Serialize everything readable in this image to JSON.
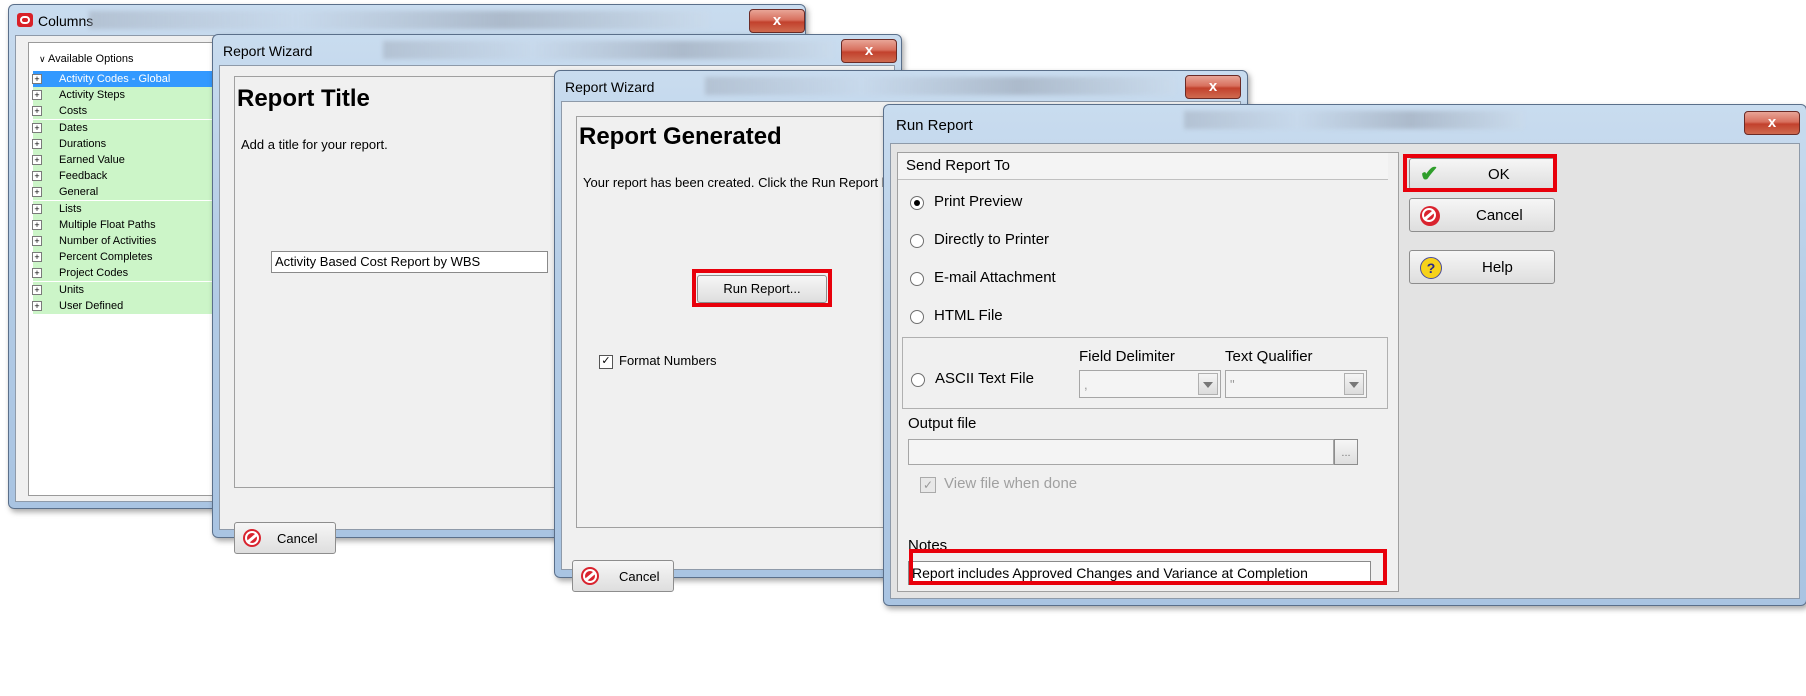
{
  "columns_window": {
    "title": "Columns",
    "tree_header": "Available Options",
    "items": [
      "Activity Codes - Global",
      "Activity Steps",
      "Costs",
      "Dates",
      "Durations",
      "Earned Value",
      "Feedback",
      "General",
      "Lists",
      "Multiple Float Paths",
      "Number of Activities",
      "Percent Completes",
      "Project Codes",
      "Units",
      "User Defined"
    ],
    "selected_index": 0,
    "close_label": "x"
  },
  "wizard1": {
    "title": "Report Wizard",
    "heading": "Report Title",
    "instruction": "Add a title for your report.",
    "title_value": "Activity Based Cost Report by WBS",
    "cancel_label": "Cancel",
    "close_label": "x"
  },
  "wizard2": {
    "title": "Report Wizard",
    "heading": "Report Generated",
    "message": "Your report has been created.  Click the Run Report b",
    "run_button_label": "Run Report...",
    "format_numbers_label": "Format Numbers",
    "format_numbers_checked": true,
    "cancel_label": "Cancel",
    "close_label": "x"
  },
  "run_report": {
    "title": "Run Report",
    "close_label": "x",
    "send_to_header": "Send Report To",
    "options": [
      {
        "label": "Print Preview",
        "selected": true
      },
      {
        "label": "Directly to Printer",
        "selected": false
      },
      {
        "label": "E-mail Attachment",
        "selected": false
      },
      {
        "label": "HTML File",
        "selected": false
      }
    ],
    "ascii_label": "ASCII Text File",
    "field_delimiter_label": "Field Delimiter",
    "field_delimiter_value": ",",
    "text_qualifier_label": "Text Qualifier",
    "text_qualifier_value": "\"",
    "output_file_label": "Output file",
    "output_file_value": "",
    "browse_label": "...",
    "view_when_done_label": "View file when done",
    "notes_label": "Notes",
    "notes_value": "Report includes Approved Changes and Variance at Completion",
    "ok_label": "OK",
    "cancel_label": "Cancel",
    "help_label": "Help"
  },
  "colors": {
    "highlight_red": "#e8000b",
    "tree_item_green": "#ccf5c8",
    "tree_selected_blue": "#3399ff"
  }
}
